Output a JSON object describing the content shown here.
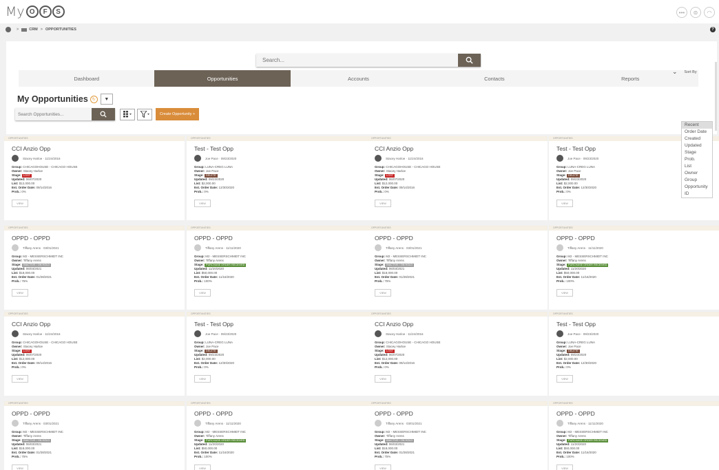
{
  "app": {
    "logo_prefix": "My",
    "logo_letters": [
      "O",
      "F",
      "S"
    ]
  },
  "top_icons": [
    "•••",
    "⊜",
    "◠"
  ],
  "breadcrumb": {
    "items": [
      "CRM",
      "OPPORTUNITIES"
    ],
    "separator": ">"
  },
  "help_icon": "?",
  "search": {
    "placeholder": "Search..."
  },
  "tabs": [
    {
      "label": "Dashboard",
      "active": false
    },
    {
      "label": "Opportunities",
      "active": true
    },
    {
      "label": "Accounts",
      "active": false
    },
    {
      "label": "Contacts",
      "active": false
    },
    {
      "label": "Reports",
      "active": false
    }
  ],
  "page": {
    "title": "My Opportunities"
  },
  "toolbar": {
    "search_placeholder": "Search Opportunities...",
    "create_label": "Create Opportunity +"
  },
  "sort": {
    "label": "Sort By",
    "options": [
      "Recent",
      "Order Date",
      "Created",
      "Updated",
      "Stage",
      "Prob.",
      "List",
      "Owner",
      "Group",
      "Opportunity",
      "ID"
    ],
    "selected": "Recent"
  },
  "colors": {
    "accent": "#6c6256",
    "create_button": "#d98c3a",
    "stage_lost": "#c62828",
    "stage_delete": "#7a4b3a",
    "stage_onhold": "#9e9e9e",
    "stage_received": "#5a8f3a"
  },
  "card_header_label": "OPPORTUNITIES",
  "field_labels": {
    "group": "Group:",
    "owner": "Owner:",
    "stage": "Stage:",
    "updated": "Updated:",
    "list": "List:",
    "order_date": "Est. Order Date:",
    "prob": "Prob.:"
  },
  "view_label": "VIEW",
  "cards": [
    {
      "title": "CCI Anzio Opp",
      "who": "Stacey Harloe · 11/24/2016",
      "group": "CHICAGOHOUSE - CHICAGO HOUSE",
      "owner": "Stacey Harloe",
      "stage": "LOST",
      "stage_color": "#c62828",
      "updated": "06/07/2020",
      "list": "$12,000.00",
      "order_date": "09/14/2016",
      "prob": "0%",
      "avatar": "dark"
    },
    {
      "title": "Test - Test Opp",
      "who": "Joe Pace · 09/23/2020",
      "group": "LUNA-CREG LUNA",
      "owner": "Joe Pace",
      "stage": "DELETE",
      "stage_color": "#7a4b3a",
      "updated": "09/23/2020",
      "list": "$2,000.00",
      "order_date": "12/30/2020",
      "prob": "0%",
      "avatar": "dark"
    },
    {
      "title": "CCI Anzio Opp",
      "who": "Stacey Harloe · 11/24/2016",
      "group": "CHICAGOHOUSE - CHICAGO HOUSE",
      "owner": "Stacey Harloe",
      "stage": "LOST",
      "stage_color": "#c62828",
      "updated": "06/07/2020",
      "list": "$12,000.00",
      "order_date": "09/14/2016",
      "prob": "0%",
      "avatar": "dark"
    },
    {
      "title": "Test - Test Opp",
      "who": "Joe Pace · 09/23/2020",
      "group": "LUNA-CREG LUNA",
      "owner": "Joe Pace",
      "stage": "DELETE",
      "stage_color": "#7a4b3a",
      "updated": "09/23/2020",
      "list": "$2,000.00",
      "order_date": "12/30/2020",
      "prob": "0%",
      "avatar": "dark"
    },
    {
      "title": "OPPD - OPPD",
      "who": "Tiffany Arens · 03/01/2021",
      "group": "M2 - MESSERSCHMIDT INC",
      "owner": "Tiffany Arens",
      "stage": "INACTIVE / ON HOLD",
      "stage_color": "#9e9e9e",
      "updated": "06/03/2021",
      "list": "$18,000.00",
      "order_date": "01/28/2021",
      "prob": "75%",
      "avatar": "light"
    },
    {
      "title": "OPPD - OPPD",
      "who": "Tiffany Arens · 11/11/2020",
      "group": "M2 - MESSERSCHMIDT INC",
      "owner": "Tiffany Arens",
      "stage": "PURCHASE ORDER RECEIVED",
      "stage_color": "#5a8f3a",
      "updated": "11/20/2020",
      "list": "$50,000.00",
      "order_date": "11/16/2020",
      "prob": "100%",
      "avatar": "light"
    },
    {
      "title": "OPPD - OPPD",
      "who": "Tiffany Arens · 03/01/2021",
      "group": "M2 - MESSERSCHMIDT INC",
      "owner": "Tiffany Arens",
      "stage": "INACTIVE / ON HOLD",
      "stage_color": "#9e9e9e",
      "updated": "06/03/2021",
      "list": "$18,000.00",
      "order_date": "01/28/2021",
      "prob": "75%",
      "avatar": "light"
    },
    {
      "title": "OPPD - OPPD",
      "who": "Tiffany Arens · 11/11/2020",
      "group": "M2 - MESSERSCHMIDT INC",
      "owner": "Tiffany Arens",
      "stage": "PURCHASE ORDER RECEIVED",
      "stage_color": "#5a8f3a",
      "updated": "11/20/2020",
      "list": "$50,000.00",
      "order_date": "11/16/2020",
      "prob": "100%",
      "avatar": "light"
    },
    {
      "title": "CCI Anzio Opp",
      "who": "Stacey Harloe · 11/24/2016",
      "group": "CHICAGOHOUSE - CHICAGO HOUSE",
      "owner": "Stacey Harloe",
      "stage": "LOST",
      "stage_color": "#c62828",
      "updated": "06/07/2020",
      "list": "$12,000.00",
      "order_date": "09/14/2016",
      "prob": "0%",
      "avatar": "dark"
    },
    {
      "title": "Test - Test Opp",
      "who": "Joe Pace · 09/23/2020",
      "group": "LUNA-CREG LUNA",
      "owner": "Joe Pace",
      "stage": "DELETE",
      "stage_color": "#7a4b3a",
      "updated": "09/23/2020",
      "list": "$2,000.00",
      "order_date": "12/30/2020",
      "prob": "0%",
      "avatar": "dark"
    },
    {
      "title": "CCI Anzio Opp",
      "who": "Stacey Harloe · 11/24/2016",
      "group": "CHICAGOHOUSE - CHICAGO HOUSE",
      "owner": "Stacey Harloe",
      "stage": "LOST",
      "stage_color": "#c62828",
      "updated": "06/07/2020",
      "list": "$12,000.00",
      "order_date": "09/14/2016",
      "prob": "0%",
      "avatar": "dark"
    },
    {
      "title": "Test - Test Opp",
      "who": "Joe Pace · 09/23/2020",
      "group": "LUNA-CREG LUNA",
      "owner": "Joe Pace",
      "stage": "DELETE",
      "stage_color": "#7a4b3a",
      "updated": "09/23/2020",
      "list": "$2,000.00",
      "order_date": "12/30/2020",
      "prob": "0%",
      "avatar": "dark"
    },
    {
      "title": "OPPD - OPPD",
      "who": "Tiffany Arens · 03/01/2021",
      "group": "M2 - MESSERSCHMIDT INC",
      "owner": "Tiffany Arens",
      "stage": "INACTIVE / ON HOLD",
      "stage_color": "#9e9e9e",
      "updated": "06/03/2021",
      "list": "$18,000.00",
      "order_date": "01/28/2021",
      "prob": "75%",
      "avatar": "light"
    },
    {
      "title": "OPPD - OPPD",
      "who": "Tiffany Arens · 11/11/2020",
      "group": "M2 - MESSERSCHMIDT INC",
      "owner": "Tiffany Arens",
      "stage": "PURCHASE ORDER RECEIVED",
      "stage_color": "#5a8f3a",
      "updated": "11/20/2020",
      "list": "$50,000.00",
      "order_date": "11/16/2020",
      "prob": "100%",
      "avatar": "light"
    },
    {
      "title": "OPPD - OPPD",
      "who": "Tiffany Arens · 03/01/2021",
      "group": "M2 - MESSERSCHMIDT INC",
      "owner": "Tiffany Arens",
      "stage": "INACTIVE / ON HOLD",
      "stage_color": "#9e9e9e",
      "updated": "06/03/2021",
      "list": "$18,000.00",
      "order_date": "01/28/2021",
      "prob": "75%",
      "avatar": "light"
    },
    {
      "title": "OPPD - OPPD",
      "who": "Tiffany Arens · 11/11/2020",
      "group": "M2 - MESSERSCHMIDT INC",
      "owner": "Tiffany Arens",
      "stage": "PURCHASE ORDER RECEIVED",
      "stage_color": "#5a8f3a",
      "updated": "11/20/2020",
      "list": "$50,000.00",
      "order_date": "11/16/2020",
      "prob": "100%",
      "avatar": "light"
    }
  ]
}
